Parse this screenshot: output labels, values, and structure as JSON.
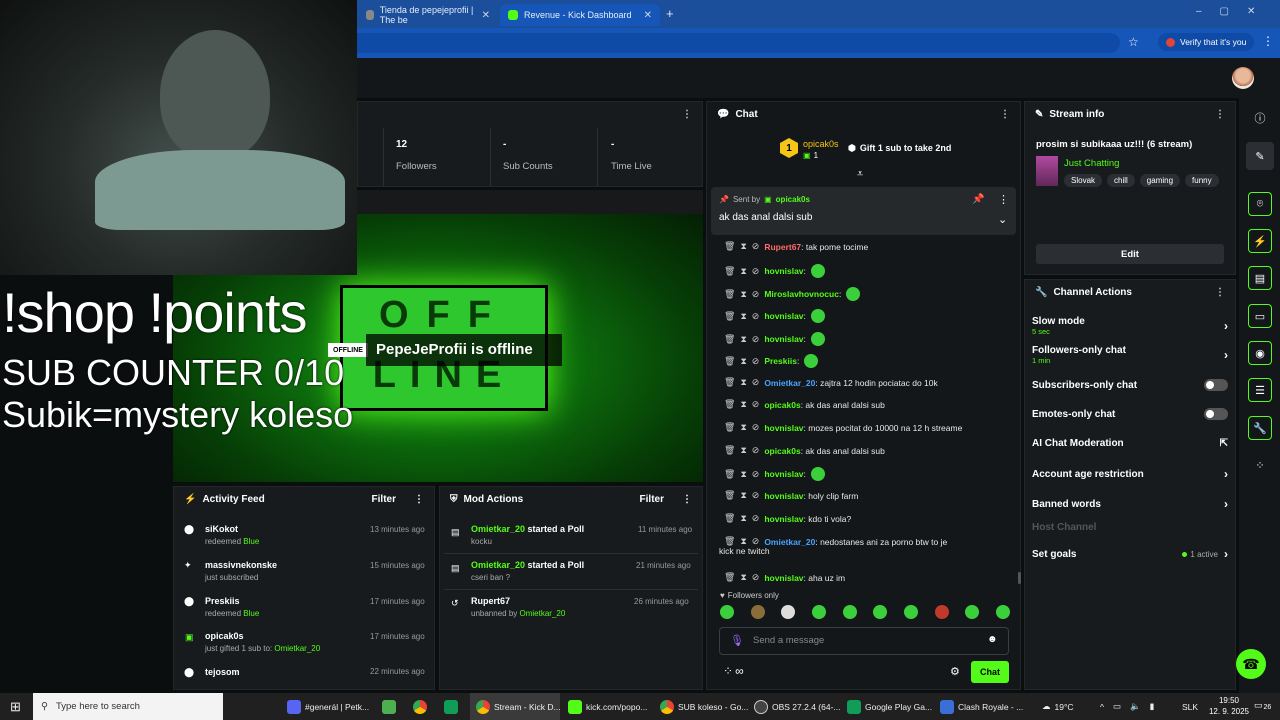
{
  "browser": {
    "tabs": [
      {
        "label": "Tienda de pepejeprofii | The be"
      },
      {
        "label": "Revenue - Kick Dashboard"
      }
    ],
    "verify_label": "Verify that it's you"
  },
  "overlay": {
    "line1": "!shop !points",
    "line2": "SUB COUNTER 0/10",
    "line3": "Subik=mystery koleso"
  },
  "stats": [
    {
      "value": "12",
      "label": "Followers"
    },
    {
      "value": "-",
      "label": "Sub Counts"
    },
    {
      "value": "-",
      "label": "Time Live"
    }
  ],
  "preview": {
    "badge": "OFFLINE",
    "status": "PepeJeProfii is offline",
    "sign_top": "OFF",
    "sign_bottom": "LINE"
  },
  "chat": {
    "title": "Chat",
    "gift_user": "opicak0s",
    "gift_count": "1",
    "gift_rank": "1",
    "gift_cta": "Gift 1 sub to take 2nd",
    "pinned_sent_by": "Sent by",
    "pinned_user": "opicak0s",
    "pinned_text": "ak das anal dalsi sub",
    "messages": [
      {
        "user": "Rupert67",
        "text": ": tak pome tocime",
        "color": "#ff6b6b"
      },
      {
        "user": "hovnislav",
        "text": ":",
        "color": "#53fc18"
      },
      {
        "user": "Miroslavhovnocuc",
        "text": ":",
        "color": "#53fc18"
      },
      {
        "user": "hovnislav",
        "text": ":",
        "color": "#53fc18"
      },
      {
        "user": "hovnislav",
        "text": ":",
        "color": "#53fc18"
      },
      {
        "user": "Preskiis",
        "text": ":",
        "color": "#53fc18"
      },
      {
        "user": "Omietkar_20",
        "text": ": zajtra 12 hodin pociatac do 10k",
        "color": "#4aa3ff"
      },
      {
        "user": "opicak0s",
        "text": ": ak das anal dalsi sub",
        "color": "#53fc18"
      },
      {
        "user": "hovnislav",
        "text": ": mozes pocitat do 10000 na 12 h streame",
        "color": "#53fc18"
      },
      {
        "user": "opicak0s",
        "text": ": ak das anal dalsi sub",
        "color": "#53fc18"
      },
      {
        "user": "hovnislav",
        "text": ":",
        "color": "#53fc18"
      },
      {
        "user": "hovnislav",
        "text": ": holy clip farm",
        "color": "#53fc18"
      },
      {
        "user": "hovnislav",
        "text": ": kdo ti vola?",
        "color": "#53fc18"
      },
      {
        "user": "Omietkar_20",
        "text": ": nedostanes ani za porno btw to je",
        "color": "#4aa3ff"
      },
      {
        "user": "hovnislav",
        "text": ": aha uz im",
        "color": "#53fc18"
      }
    ],
    "wrap_line": "kick ne twitch",
    "followers_only": "Followers only",
    "placeholder": "Send a message",
    "send_label": "Chat"
  },
  "stream_info": {
    "title": "Stream info",
    "stream_title": "prosim si subikaaa uz!!! (6 stream)",
    "category": "Just Chatting",
    "tags": [
      "Slovak",
      "chill",
      "gaming",
      "funny"
    ],
    "edit_label": "Edit"
  },
  "channel_actions": {
    "title": "Channel Actions",
    "slow_mode": "Slow mode",
    "slow_mode_value": "5 sec",
    "followers_only": "Followers-only chat",
    "followers_only_value": "1 min",
    "subscribers_only": "Subscribers-only chat",
    "emotes_only": "Emotes-only chat",
    "ai_moderation": "AI Chat Moderation",
    "account_age": "Account age restriction",
    "banned_words": "Banned words",
    "host_channel": "Host Channel",
    "set_goals": "Set goals",
    "goals_active": "1 active"
  },
  "activity": {
    "title": "Activity Feed",
    "filter": "Filter",
    "items": [
      {
        "user": "siKokot",
        "sub": "redeemed ",
        "extra": "Blue",
        "time": "13 minutes ago"
      },
      {
        "user": "massivnekonske",
        "sub": "just subscribed",
        "extra": "",
        "time": "15 minutes ago"
      },
      {
        "user": "Preskiis",
        "sub": "redeemed ",
        "extra": "Blue",
        "time": "17 minutes ago"
      },
      {
        "user": "opicak0s",
        "sub": "just gifted 1 sub to: ",
        "extra": "Omietkar_20",
        "time": "17 minutes ago"
      },
      {
        "user": "tejosom",
        "sub": "redeemed ",
        "extra": "Blue",
        "time": "22 minutes ago"
      }
    ]
  },
  "mod": {
    "title": "Mod Actions",
    "filter": "Filter",
    "items": [
      {
        "user": "Omietkar_20",
        "action": " started a Poll",
        "sub": "kocku",
        "time": "11 minutes ago"
      },
      {
        "user": "Omietkar_20",
        "action": " started a Poll",
        "sub": "cseri ban ?",
        "time": "21 minutes ago"
      },
      {
        "user": "Rupert67",
        "action": "",
        "sub": "unbanned by ",
        "subuser": "Omietkar_20",
        "time": "26 minutes ago"
      }
    ]
  },
  "taskbar": {
    "search": "Type here to search",
    "apps": [
      {
        "label": "#generál | Petk..."
      },
      {
        "label": "Stream - Kick D..."
      },
      {
        "label": "kick.com/popo..."
      },
      {
        "label": "SUB koleso - Go..."
      },
      {
        "label": "OBS 27.2.4 (64-..."
      },
      {
        "label": "Google Play Ga..."
      },
      {
        "label": "Clash Royale - ..."
      }
    ],
    "weather": "19°C",
    "lang": "SLK",
    "time": "19:50",
    "date": "12. 9. 2025",
    "notif": "26"
  }
}
